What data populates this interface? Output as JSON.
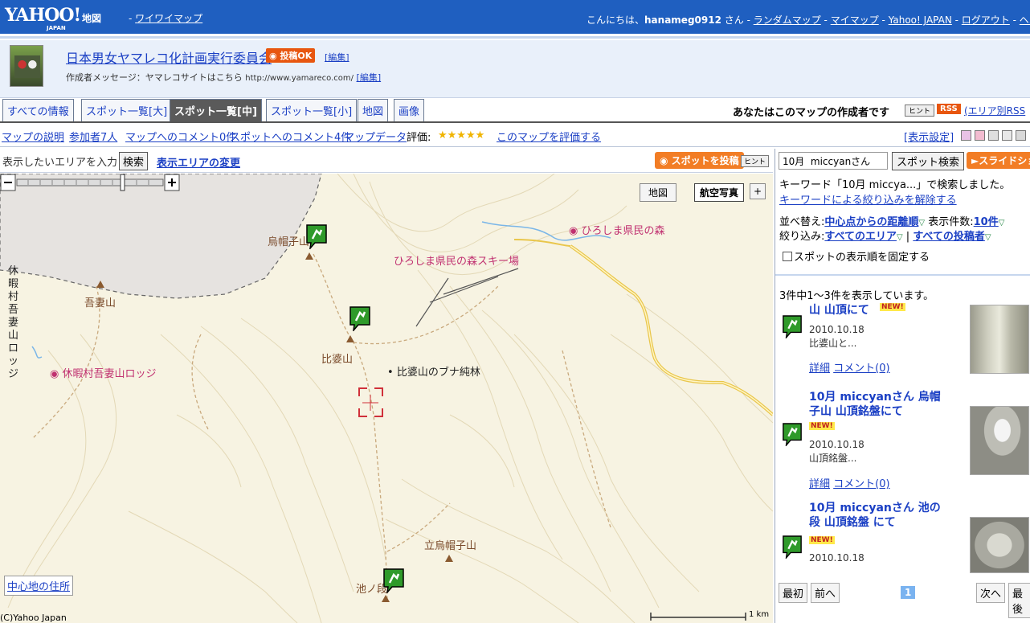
{
  "topbar": {
    "logo": "YAHOO!",
    "logo_sub": "JAPAN",
    "service": "地図",
    "waiwai_prefix": "- ",
    "waiwai": "ワイワイマップ",
    "greeting": "こんにちは、",
    "user": "hanameg0912",
    "san": " さん - ",
    "links": [
      "ランダムマップ",
      "マイマップ",
      "Yahoo! JAPAN",
      "ログアウト",
      "ヘルプ"
    ]
  },
  "owner": {
    "title": "日本男女ヤマレコ化計画実行委員会",
    "post_ok": "投稿OK",
    "edit": "[編集]",
    "message_label": "作成者メッセージ：ヤマレコサイトはこちら",
    "message_url": "http://www.yamareco.com/",
    "message_edit": "[編集]"
  },
  "tabs": {
    "items": [
      "すべての情報",
      "スポット一覧[大]",
      "スポット一覧[中]",
      "スポット一覧[小]",
      "地図",
      "画像"
    ],
    "author_note": "あなたはこのマップの作成者です",
    "hint": "ヒント",
    "rss": "RSS",
    "rss_area": "(エリア別RSS"
  },
  "info": {
    "links": [
      "マップの説明",
      "参加者7人",
      "マップへのコメント0件",
      "スポットへのコメント4件",
      "マップデータ"
    ],
    "rating_label": "評価:",
    "rating_value": 5,
    "stars": "★★★★★",
    "rate_link": "このマップを評価する",
    "display_settings": "[表示設定]",
    "swatch_colors": [
      "#e9c2e6",
      "#f3bcd0",
      "#dedede",
      "#e8e8e8",
      "#d9d9d9"
    ]
  },
  "search": {
    "area_placeholder": "表示したいエリアを入力",
    "search_btn": "検索",
    "area_change": "表示エリアの変更",
    "post_spot": "スポットを投稿",
    "hint": "ヒント"
  },
  "map": {
    "map_btn": "地図",
    "aerial_btn": "航空写真",
    "grid_btn": "+",
    "center_address": "中心地の住所",
    "copyright": "(C)Yahoo Japan",
    "scale": "1 km",
    "labels": {
      "eboshi": "烏帽子山",
      "azuma": "吾妻山",
      "kyuka_vertical": "休暇村吾妻山ロッジ",
      "kyuka": "休暇村吾妻山ロッジ",
      "hiba": "比婆山",
      "buna": "比婆山のブナ純林",
      "ski": "ひろしま県民の森スキー場",
      "forest": "ひろしま県民の森",
      "tateeboshi": "立烏帽子山",
      "ikenodan": "池ノ段"
    }
  },
  "panel": {
    "keyword": "10月  miccyanさん",
    "spot_search": "スポット検索",
    "slideshow": "スライドショー",
    "kw_message": "キーワード「10月  miccya...」で検索しました。",
    "kw_clear": "キーワードによる絞り込みを解除する",
    "sort_label": "並べ替え:",
    "sort_value": "中心点からの距離順",
    "count_label": "表示件数:",
    "count_value": "10件",
    "filter_label": "絞り込み:",
    "filter_area": "すべてのエリア",
    "filter_poster": "すべての投稿者",
    "fix_order": "スポットの表示順を固定する",
    "result_count": "3件中1〜3件を表示しています。",
    "spots": [
      {
        "title": "山 山頂にて",
        "new": "NEW!",
        "date": "2010.10.18",
        "desc": "比婆山と...",
        "detail": "詳細",
        "comment": "コメント(0)"
      },
      {
        "title": "10月  miccyanさん 烏帽子山 山頂銘盤にて",
        "new": "NEW!",
        "date": "2010.10.18",
        "desc": "山頂銘盤...",
        "detail": "詳細",
        "comment": "コメント(0)"
      },
      {
        "title": "10月  miccyanさん  池の段 山頂銘盤 にて",
        "new": "NEW!",
        "date": "2010.10.18",
        "desc": "",
        "detail": "",
        "comment": ""
      }
    ],
    "pager": {
      "first": "最初",
      "prev": "前へ",
      "current": "1",
      "next": "次へ",
      "last": "最後"
    }
  },
  "colors": {
    "brand_blue": "#1f5fc0",
    "accent_orange": "#f27d25",
    "link": "#1a3fc4",
    "pin_green": "#2f9a2a"
  }
}
